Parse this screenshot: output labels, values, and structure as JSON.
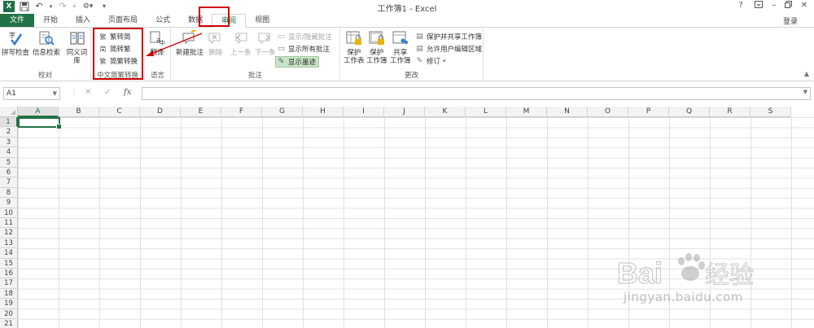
{
  "window": {
    "title": "工作簿1 - Excel",
    "help": "?",
    "sign_in": "登录"
  },
  "tabs": [
    {
      "label": "文件"
    },
    {
      "label": "开始"
    },
    {
      "label": "插入"
    },
    {
      "label": "页面布局"
    },
    {
      "label": "公式"
    },
    {
      "label": "数据"
    },
    {
      "label": "审阅"
    },
    {
      "label": "视图"
    }
  ],
  "active_tab": "审阅",
  "ribbon": {
    "proofing": {
      "label": "校对",
      "spelling": "拼写检查",
      "research": "信息检索",
      "thesaurus": "同义词库"
    },
    "chinese_conversion": {
      "label": "中文简繁转换",
      "to_simplified": "繁转简",
      "to_traditional": "简转繁",
      "convert": "简繁转换"
    },
    "language": {
      "label": "语言",
      "translate": "翻译"
    },
    "comments": {
      "label": "批注",
      "new": "新建批注",
      "delete": "删除",
      "previous": "上一条",
      "next": "下一条",
      "show_hide": "显示/隐藏批注",
      "show_all": "显示所有批注",
      "show_ink": "显示墨迹"
    },
    "changes": {
      "label": "更改",
      "protect_sheet_1": "保护",
      "protect_sheet_2": "工作表",
      "protect_workbook_1": "保护",
      "protect_workbook_2": "工作簿",
      "share_workbook_1": "共享",
      "share_workbook_2": "工作簿",
      "protect_share": "保护并共享工作簿",
      "allow_edit": "允许用户编辑区域",
      "track_changes": "修订"
    }
  },
  "formula_bar": {
    "name_box": "A1",
    "cancel": "✕",
    "enter": "✓",
    "fx": "fx",
    "value": ""
  },
  "grid": {
    "columns": [
      "A",
      "B",
      "C",
      "D",
      "E",
      "F",
      "G",
      "H",
      "I",
      "J",
      "K",
      "L",
      "M",
      "N",
      "O",
      "P",
      "Q",
      "R",
      "S"
    ],
    "rows": [
      "1",
      "2",
      "3",
      "4",
      "5",
      "6",
      "7",
      "8",
      "9",
      "10",
      "11",
      "12",
      "13",
      "14",
      "15",
      "16",
      "17",
      "18",
      "19",
      "20",
      "21"
    ],
    "active_cell": "A1"
  },
  "watermark": {
    "brand": "Bai 经验",
    "url": "jingyan.baidu.com"
  },
  "colors": {
    "excel_green": "#217346",
    "highlight_red": "#cc0000"
  }
}
